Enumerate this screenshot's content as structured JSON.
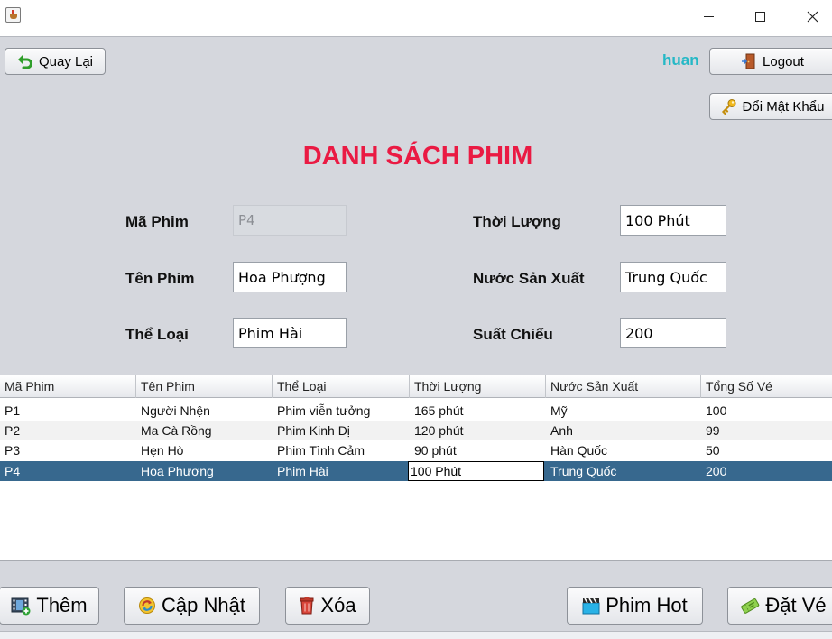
{
  "window": {
    "minimize": "minimize",
    "maximize": "maximize",
    "close": "close"
  },
  "header": {
    "back_label": "Quay Lại",
    "username": "huan",
    "logout_label": "Logout",
    "change_password_label": "Đổi Mật Khẩu"
  },
  "title": "DANH SÁCH PHIM",
  "form": {
    "ma_phim_label": "Mã Phim",
    "ma_phim_value": "P4",
    "ten_phim_label": "Tên Phim",
    "ten_phim_value": "Hoa Phượng",
    "the_loai_label": "Thể Loại",
    "the_loai_value": "Phim Hài",
    "thoi_luong_label": "Thời Lượng",
    "thoi_luong_value": "100 Phút",
    "nuoc_san_xuat_label": "Nước Sản Xuất",
    "nuoc_san_xuat_value": "Trung Quốc",
    "suat_chieu_label": "Suất Chiếu",
    "suat_chieu_value": "200"
  },
  "table": {
    "columns": [
      "Mã Phim",
      "Tên Phim",
      "Thể Loại",
      "Thời Lượng",
      "Nước Sản Xuất",
      "Tổng Số Vé"
    ],
    "rows": [
      [
        "P1",
        "Người Nhện",
        "Phim viễn tưởng",
        "165 phút",
        "Mỹ",
        "100"
      ],
      [
        "P2",
        "Ma Cà Rồng",
        "Phim Kinh Dị",
        "120 phút",
        "Anh",
        "99"
      ],
      [
        "P3",
        "Hẹn Hò",
        "Phim Tình Cảm",
        "90 phút",
        "Hàn Quốc",
        "50"
      ],
      [
        "P4",
        "Hoa Phượng",
        "Phim Hài",
        "100 Phút",
        "Trung Quốc",
        "200"
      ]
    ],
    "selected_row": 3
  },
  "actions": {
    "add_label": "Thêm",
    "update_label": "Cập Nhật",
    "delete_label": "Xóa",
    "hot_label": "Phim Hot",
    "book_label": "Đặt Vé"
  },
  "icons": {
    "app": "java-cup-icon",
    "back": "green-undo-arrow-icon",
    "logout": "door-exit-icon",
    "password": "key-icon",
    "add": "film-add-icon",
    "update": "refresh-icon",
    "delete": "trash-icon",
    "hot": "clapperboard-icon",
    "book": "ticket-icon"
  },
  "colors": {
    "title": "#ea1a43",
    "username": "#25b8c6",
    "selected_row": "#37688e",
    "panel": "#d5d7dd"
  }
}
